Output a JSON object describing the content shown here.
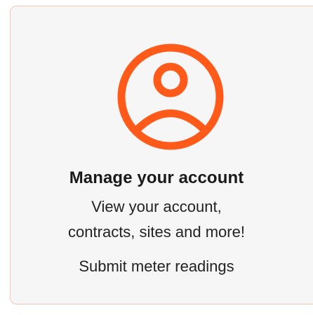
{
  "card": {
    "icon": "account-user-circle-icon",
    "title": "Manage your account",
    "description_line1": "View your account,",
    "description_line2": "contracts, sites and more!",
    "link_text": "Submit meter readings"
  },
  "colors": {
    "accent": "#ff5a1a",
    "card_border": "#f2c7b8",
    "card_background": "#f6f6f6",
    "text": "#1a1a1a"
  }
}
